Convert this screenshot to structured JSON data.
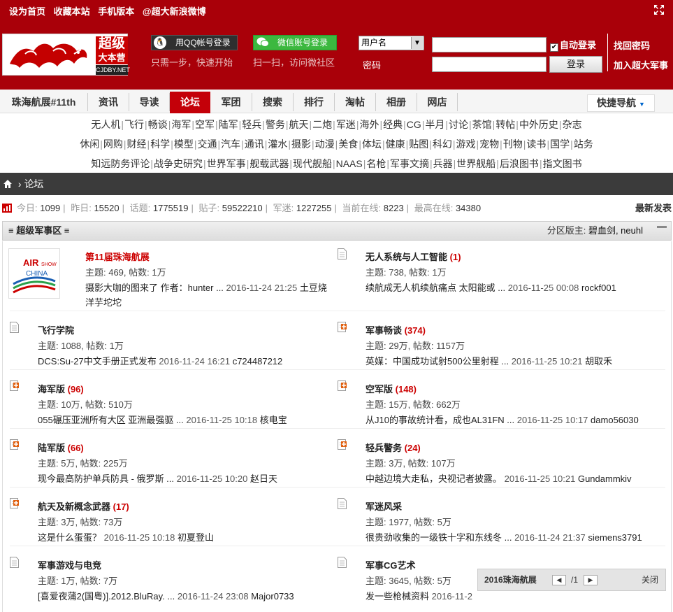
{
  "header": {
    "top_links": [
      "设为首页",
      "收藏本站",
      "手机版本",
      "@超大新浪微博"
    ],
    "logo_text_1": "超级",
    "logo_text_2": "大本营",
    "logo_domain": "CJDBY.NET",
    "qq_login": "用QQ帐号登录",
    "qq_sub": "只需一步，快速开始",
    "wechat_login": "微信账号登录",
    "wechat_sub": "扫一扫，访问微社区",
    "username_select": "用户名",
    "password_label": "密码",
    "auto_login": "自动登录",
    "login_button": "登录",
    "find_password": "找回密码",
    "join": "加入超大军事"
  },
  "nav": {
    "items": [
      "珠海航展#11th",
      "资讯",
      "导读",
      "论坛",
      "军团",
      "搜索",
      "排行",
      "淘帖",
      "相册",
      "网店"
    ],
    "active": "论坛",
    "quick_nav": "快捷导航"
  },
  "subnav": {
    "row1": [
      "无人机",
      "飞行",
      "畅谈",
      "海军",
      "空军",
      "陆军",
      "轻兵",
      "警务",
      "航天",
      "二炮",
      "军迷",
      "海外",
      "经典",
      "CG",
      "半月",
      "讨论",
      "茶馆",
      "转帖",
      "中外历史",
      "杂志"
    ],
    "row2": [
      "休闲",
      "网购",
      "财经",
      "科学",
      "模型",
      "交通",
      "汽车",
      "通讯",
      "灌水",
      "摄影",
      "动漫",
      "美食",
      "体坛",
      "健康",
      "贴图",
      "科幻",
      "游戏",
      "宠物",
      "刊物",
      "读书",
      "国学",
      "站务"
    ],
    "row3": [
      "知远防务评论",
      "战争史研究",
      "世界军事",
      "舰载武器",
      "现代舰船",
      "NAAS",
      "名枪",
      "军事文摘",
      "兵器",
      "世界舰船",
      "后浪图书",
      "指文图书"
    ]
  },
  "breadcrumb": {
    "separator": "›",
    "current": "论坛"
  },
  "stats": {
    "today_label": "今日:",
    "today": "1099",
    "yesterday_label": "昨日:",
    "yesterday": "15520",
    "topics_label": "话题:",
    "topics": "1775519",
    "posts_label": "贴子:",
    "posts": "59522210",
    "members_label": "军迷:",
    "members": "1227255",
    "online_label": "当前在线:",
    "online": "8223",
    "max_online_label": "最高在线:",
    "max_online": "34380",
    "new_posts": "最新发表"
  },
  "zone": {
    "title": "≡ 超级军事区 ≡",
    "mods_label": "分区版主:",
    "mods": "碧血剑, neuhl"
  },
  "forums": [
    {
      "name": "第11届珠海航展",
      "count": "",
      "meta": "主题: 469, 帖数: 1万",
      "last": "摄影大咖的图来了 作者：hunter ...",
      "time": "2016-11-24 21:25",
      "user": "土豆烧洋芋坨坨",
      "icon": "airshow-logo"
    },
    {
      "name": "无人系统与人工智能",
      "count": "(1)",
      "meta": "主题: 738, 帖数: 1万",
      "last": "续航成无人机续航痛点 太阳能或 ...",
      "time": "2016-11-25 00:08",
      "user": "rockf001",
      "icon": "doc-icon"
    },
    {
      "name": "飞行学院",
      "count": "",
      "meta": "主题: 1088, 帖数: 1万",
      "last": "DCS:Su-27中文手册正式发布",
      "time": "2016-11-24 16:21",
      "user": "c724487212",
      "icon": "doc-icon"
    },
    {
      "name": "军事畅谈",
      "count": "(374)",
      "meta": "主题: 29万, 帖数: 1157万",
      "last": "英媒：中国成功试射500公里射程 ...",
      "time": "2016-11-25 10:21",
      "user": "胡取禾",
      "icon": "new-doc-icon"
    },
    {
      "name": "海军版",
      "count": "(96)",
      "meta": "主题: 10万, 帖数: 510万",
      "last": "055碾压亚洲所有大区 亚洲最强驱 ...",
      "time": "2016-11-25 10:18",
      "user": "核电宝",
      "icon": "new-doc-icon"
    },
    {
      "name": "空军版",
      "count": "(148)",
      "meta": "主题: 15万, 帖数: 662万",
      "last": "从J10的事故统计看，成也AL31FN ...",
      "time": "2016-11-25 10:17",
      "user": "damo56030",
      "icon": "new-doc-icon"
    },
    {
      "name": "陆军版",
      "count": "(66)",
      "meta": "主题: 5万, 帖数: 225万",
      "last": "现今最高防护单兵防具 - 俄罗斯 ...",
      "time": "2016-11-25 10:20",
      "user": "赵日天",
      "icon": "new-doc-icon"
    },
    {
      "name": "轻兵警务",
      "count": "(24)",
      "meta": "主题: 3万, 帖数: 107万",
      "last": "中越边境大走私，央视记者披露。",
      "time": "2016-11-25 10:21",
      "user": "Gundammkiv",
      "icon": "new-doc-icon"
    },
    {
      "name": "航天及新概念武器",
      "count": "(17)",
      "meta": "主题: 3万, 帖数: 73万",
      "last": "这是什么蛋蛋？",
      "time": "2016-11-25 10:18",
      "user": "初夏登山",
      "icon": "new-doc-icon"
    },
    {
      "name": "军迷风采",
      "count": "",
      "meta": "主题: 1977, 帖数: 5万",
      "last": "很贵劲收集的一级铁十字和东线冬 ...",
      "time": "2016-11-24 21:37",
      "user": "siemens3791",
      "icon": "doc-icon"
    },
    {
      "name": "军事游戏与电竞",
      "count": "",
      "meta": "主题: 1万, 帖数: 7万",
      "last": "[喜爱夜蒲2(国粤)].2012.BluRay. ...",
      "time": "2016-11-24 23:08",
      "user": "Major0733",
      "icon": "doc-icon"
    },
    {
      "name": "军事CG艺术",
      "count": "",
      "meta": "主题: 3645, 帖数: 5万",
      "last": "发一些枪械资料",
      "time": "2016-11-2",
      "user": "",
      "icon": "doc-icon"
    }
  ],
  "popup": {
    "title": "2016珠海航展",
    "prev": "◀",
    "page": "/1",
    "next": "▶",
    "close": "关闭"
  },
  "airshow_logo": {
    "line1": "AIR",
    "line2": "SHOW",
    "line3": "CHINA"
  },
  "colors": {
    "brand_red": "#a90009",
    "active_tab": "#c40009",
    "highlight_red": "#cc0000",
    "wechat_green": "#3cb83f"
  }
}
